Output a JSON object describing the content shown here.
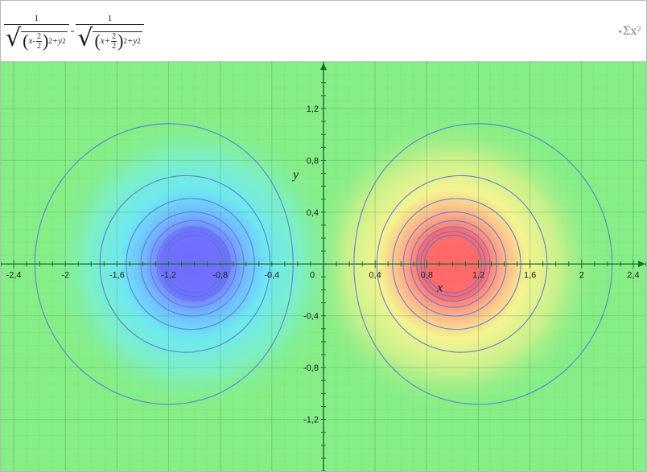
{
  "formula": {
    "num1": "1",
    "num2": "1",
    "var_x": "x",
    "minus1": "-",
    "plus1": "+",
    "frac_num": "2",
    "frac_den": "2",
    "exp": "2",
    "plus_y": "+y",
    "minus_main": "-"
  },
  "toolbar": {
    "sigma_label": "Σx²",
    "menu_glyph": "▾"
  },
  "colors": {
    "field_mid": "#86ee86",
    "neg_core": "#7070ff",
    "pos_core": "#ff6a6a",
    "contour": "#5577dd",
    "axis": "#1c6b2c"
  },
  "chart_data": {
    "type": "heatmap",
    "function": "1/sqrt((x-2/2)^2+y^2) - 1/sqrt((x+2/2)^2+y^2)",
    "xlabel": "x",
    "ylabel": "y",
    "xlim": [
      -2.5,
      2.5
    ],
    "ylim": [
      -1.6,
      1.56
    ],
    "grid": true,
    "x_ticks": [
      {
        "v": -2.4,
        "label": "-2,4"
      },
      {
        "v": -2,
        "label": "-2"
      },
      {
        "v": -1.6,
        "label": "-1,6"
      },
      {
        "v": -1.2,
        "label": "-1,2"
      },
      {
        "v": -0.8,
        "label": "-0,8"
      },
      {
        "v": -0.4,
        "label": "-0,4"
      },
      {
        "v": 0,
        "label": "0"
      },
      {
        "v": 0.4,
        "label": "0,4"
      },
      {
        "v": 0.8,
        "label": "0,8"
      },
      {
        "v": 1.2,
        "label": "1,2"
      },
      {
        "v": 1.6,
        "label": "1,6"
      },
      {
        "v": 2,
        "label": "2"
      },
      {
        "v": 2.4,
        "label": "2,4"
      }
    ],
    "y_ticks": [
      {
        "v": 1.2,
        "label": "1,2"
      },
      {
        "v": 0.8,
        "label": "0,8"
      },
      {
        "v": 0.4,
        "label": "0,4"
      },
      {
        "v": -0.4,
        "label": "-0,4"
      },
      {
        "v": -0.8,
        "label": "-0,8"
      },
      {
        "v": -1.2,
        "label": "-1,2"
      }
    ],
    "contour_levels": [
      0.5,
      1,
      1.5,
      2,
      2.5,
      3,
      3.5,
      4
    ],
    "poles": [
      {
        "x": 1,
        "y": 0,
        "sign": "positive"
      },
      {
        "x": -1,
        "y": 0,
        "sign": "negative"
      }
    ]
  }
}
